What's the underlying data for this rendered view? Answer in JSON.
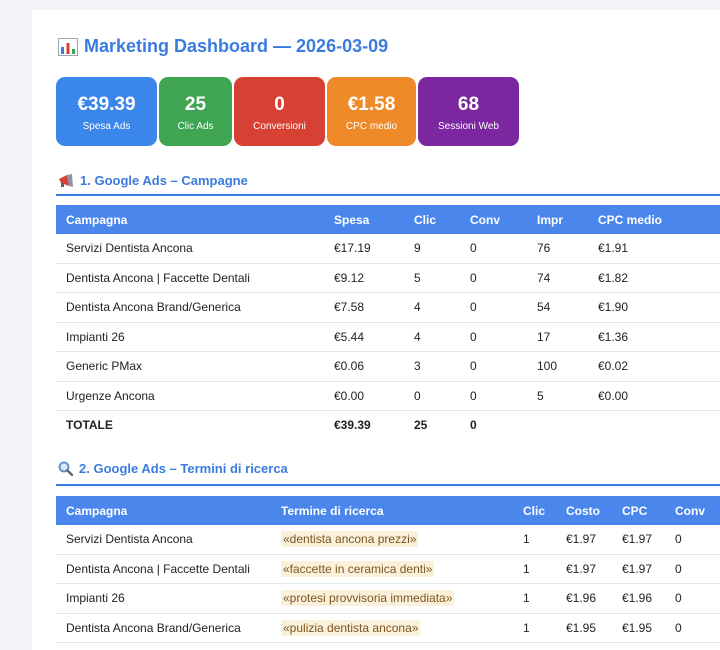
{
  "dashboard": {
    "title": "Marketing Dashboard — 2026-03-09"
  },
  "colors": {
    "accent": "#3b7be0",
    "header": "#4a86ec",
    "spend": "#3b86ea",
    "clicks": "#3fa553",
    "conversions": "#d74133",
    "cpc": "#ee8a28",
    "sessions": "#7a27a0"
  },
  "kpis": [
    {
      "value": "€39.39",
      "label": "Spesa Ads"
    },
    {
      "value": "25",
      "label": "Clic Ads"
    },
    {
      "value": "0",
      "label": "Conversioni"
    },
    {
      "value": "€1.58",
      "label": "CPC medio"
    },
    {
      "value": "68",
      "label": "Sessioni Web"
    }
  ],
  "section1": {
    "title": "1. Google Ads – Campagne",
    "icon": "megaphone-icon",
    "headers": [
      "Campagna",
      "Spesa",
      "Clic",
      "Conv",
      "Impr",
      "CPC medio"
    ],
    "rows": [
      [
        "Servizi Dentista Ancona",
        "€17.19",
        "9",
        "0",
        "76",
        "€1.91"
      ],
      [
        "Dentista Ancona | Faccette Dentali",
        "€9.12",
        "5",
        "0",
        "74",
        "€1.82"
      ],
      [
        "Dentista Ancona Brand/Generica",
        "€7.58",
        "4",
        "0",
        "54",
        "€1.90"
      ],
      [
        "Impianti 26",
        "€5.44",
        "4",
        "0",
        "17",
        "€1.36"
      ],
      [
        "Generic PMax",
        "€0.06",
        "3",
        "0",
        "100",
        "€0.02"
      ],
      [
        "Urgenze Ancona",
        "€0.00",
        "0",
        "0",
        "5",
        "€0.00"
      ]
    ],
    "total": [
      "TOTALE",
      "€39.39",
      "25",
      "0",
      "",
      ""
    ]
  },
  "section2": {
    "title": "2. Google Ads – Termini di ricerca",
    "icon": "magnifier-icon",
    "headers": [
      "Campagna",
      "Termine di ricerca",
      "Clic",
      "Costo",
      "CPC",
      "Conv"
    ],
    "rows": [
      [
        "Servizi Dentista Ancona",
        "«dentista ancona prezzi»",
        "1",
        "€1.97",
        "€1.97",
        "0"
      ],
      [
        "Dentista Ancona | Faccette Dentali",
        "«faccette in ceramica denti»",
        "1",
        "€1.97",
        "€1.97",
        "0"
      ],
      [
        "Impianti 26",
        "«protesi provvisoria immediata»",
        "1",
        "€1.96",
        "€1.96",
        "0"
      ],
      [
        "Dentista Ancona Brand/Generica",
        "«pulizia dentista ancona»",
        "1",
        "€1.95",
        "€1.95",
        "0"
      ]
    ]
  }
}
